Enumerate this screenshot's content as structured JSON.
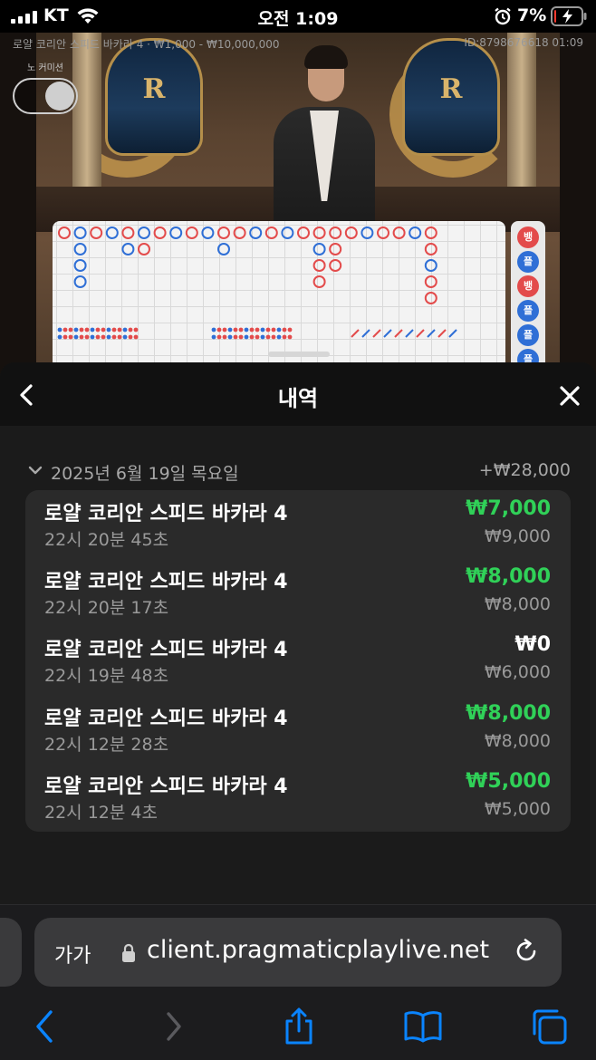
{
  "status_bar": {
    "carrier": "KT",
    "time": "오전 1:09",
    "battery_percent": "7%",
    "battery_level": 0.07,
    "icons": [
      "signal-icon",
      "wifi-icon",
      "alarm-icon",
      "battery-icon"
    ]
  },
  "game": {
    "title": "로얄 코리안 스피드 바카라 4 · ₩1,000 - ₩10,000,000",
    "id_time": "ID:8798676618   01:09",
    "no_commission_label": "노 커미션",
    "crest_letter": "R",
    "prediction": [
      "뱅",
      "플",
      "뱅",
      "플",
      "플",
      "플"
    ]
  },
  "colors": {
    "green": "#30d158",
    "banker_red": "#e34b4b",
    "player_blue": "#2f6fd6",
    "card_bg": "#2a2a2a",
    "sheet_bg": "#1b1b1b"
  },
  "sheet": {
    "title": "내역",
    "back_icon": "chevron-left-icon",
    "close_icon": "close-icon",
    "date_label": "2025년 6월 19일 목요일",
    "date_total": "+₩28,000",
    "rows": [
      {
        "name": "로얄 코리안 스피드 바카라 4",
        "time": "22시 20분 45초",
        "win": "₩7,000",
        "bet": "₩9,000",
        "positive": true
      },
      {
        "name": "로얄 코리안 스피드 바카라 4",
        "time": "22시 20분 17초",
        "win": "₩8,000",
        "bet": "₩8,000",
        "positive": true
      },
      {
        "name": "로얄 코리안 스피드 바카라 4",
        "time": "22시 19분 48초",
        "win": "₩0",
        "bet": "₩6,000",
        "positive": false
      },
      {
        "name": "로얄 코리안 스피드 바카라 4",
        "time": "22시 12분 28초",
        "win": "₩8,000",
        "bet": "₩8,000",
        "positive": true
      },
      {
        "name": "로얄 코리안 스피드 바카라 4",
        "time": "22시 12분 4초",
        "win": "₩5,000",
        "bet": "₩5,000",
        "positive": true
      }
    ]
  },
  "browser": {
    "aa_label": "가가",
    "url": "client.pragmaticplaylive.net",
    "toolbar_icons": [
      "back-icon",
      "forward-icon",
      "share-icon",
      "bookmarks-icon",
      "tabs-icon"
    ]
  }
}
